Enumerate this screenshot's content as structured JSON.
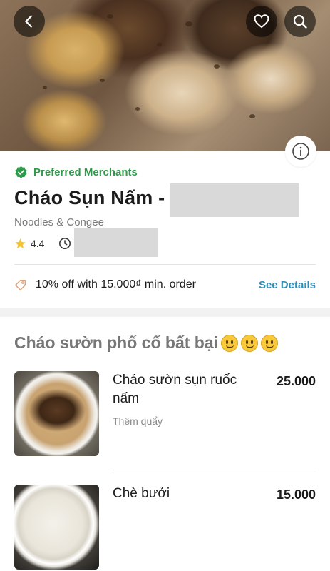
{
  "header": {
    "back_icon": "back-arrow-icon",
    "favorite_icon": "heart-icon",
    "search_icon": "search-icon",
    "info_icon": "info-icon"
  },
  "merchant": {
    "badge_label": "Preferred Merchants",
    "name": "Cháo Sụn Nấm -",
    "category": "Noodles & Congee",
    "rating": "4.4"
  },
  "promo": {
    "text": "10% off with 15.000₫ min. order",
    "link_label": "See Details"
  },
  "menu": {
    "section_title": "Cháo sườn phố cổ bất bại",
    "section_emoji_count": 3,
    "items": [
      {
        "name": "Cháo sườn sụn ruốc nấm",
        "description": "Thêm quẩy",
        "price": "25.000"
      },
      {
        "name": "Chè bưởi",
        "description": "",
        "price": "15.000"
      }
    ]
  },
  "colors": {
    "preferred_green": "#2f9b4a",
    "link_blue": "#2e8fb8",
    "star_yellow": "#f4c430"
  }
}
